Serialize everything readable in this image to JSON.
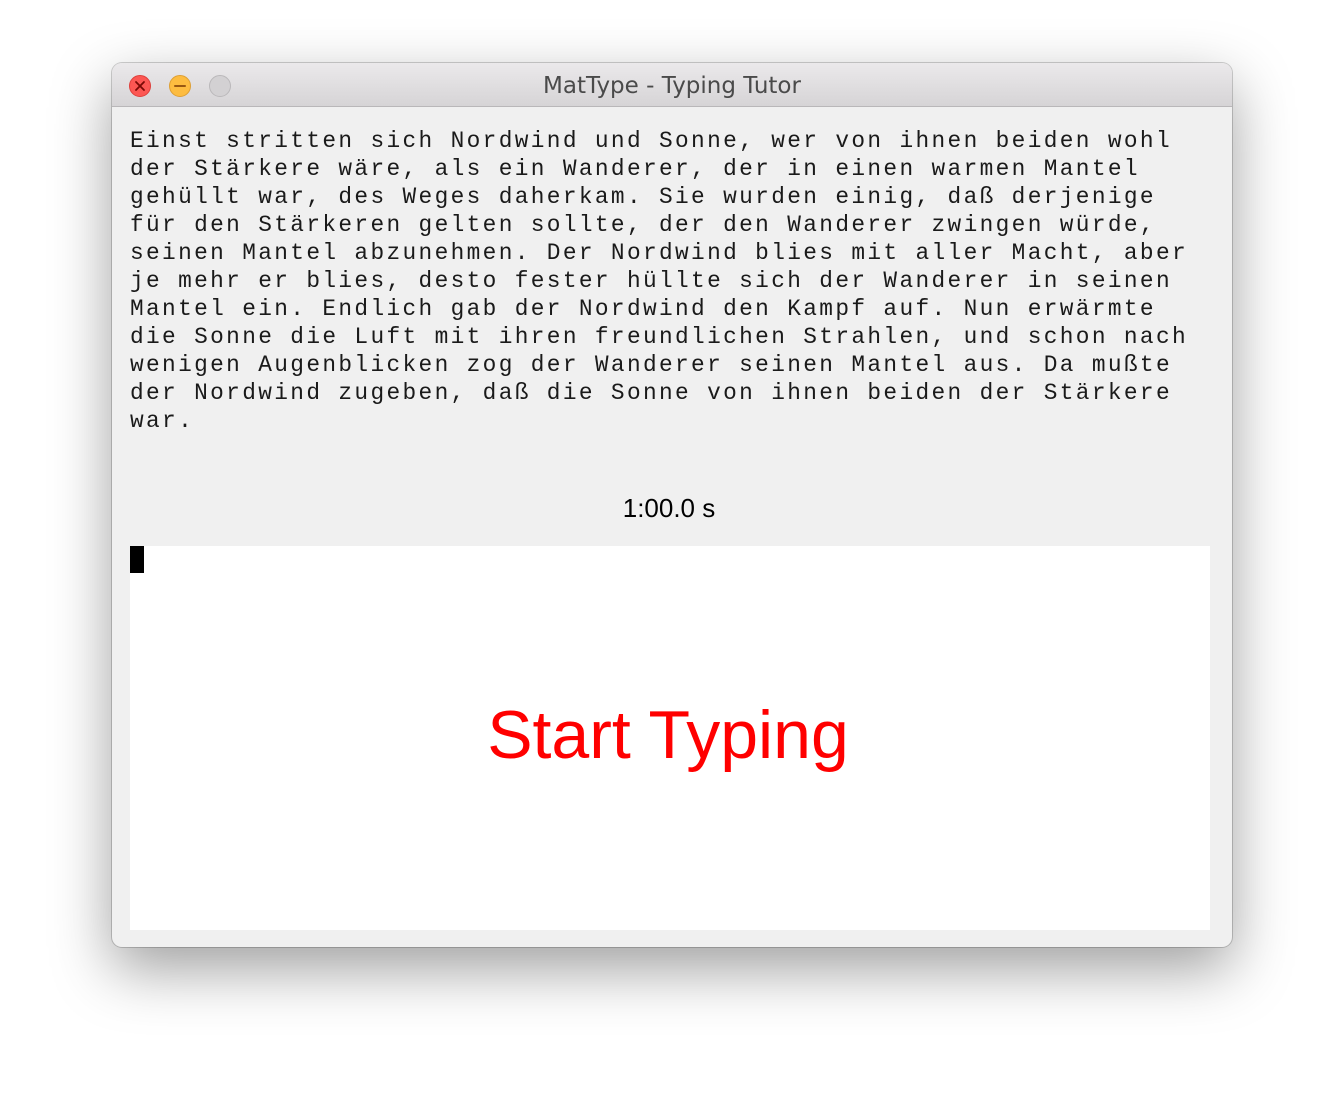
{
  "window": {
    "title": "MatType - Typing Tutor",
    "buttons": {
      "close_icon": "close-icon",
      "minimize_icon": "minimize-icon",
      "zoom_icon": "zoom-icon"
    }
  },
  "passage": {
    "lines": [
      "Einst stritten sich Nordwind und Sonne, wer von ihnen beiden wohl",
      "der Stärkere wäre, als ein Wanderer, der in einen warmen Mantel",
      "gehüllt war, des Weges daherkam. Sie wurden einig, daß derjenige",
      "für den Stärkeren gelten sollte, der den Wanderer zwingen würde,",
      "seinen Mantel abzunehmen. Der Nordwind blies mit aller Macht, aber",
      "je mehr er blies, desto fester hüllte sich der Wanderer in seinen",
      "Mantel ein. Endlich gab der Nordwind den Kampf auf. Nun erwärmte",
      "die Sonne die Luft mit ihren freundlichen Strahlen, und schon nach",
      "wenigen Augenblicken zog der Wanderer seinen Mantel aus. Da mußte",
      "der Nordwind zugeben, daß die Sonne von ihnen beiden der Stärkere",
      "war."
    ]
  },
  "timer": {
    "text": "1:00.0 s"
  },
  "typing_area": {
    "prompt": "Start Typing",
    "prompt_color": "#ff0000"
  }
}
